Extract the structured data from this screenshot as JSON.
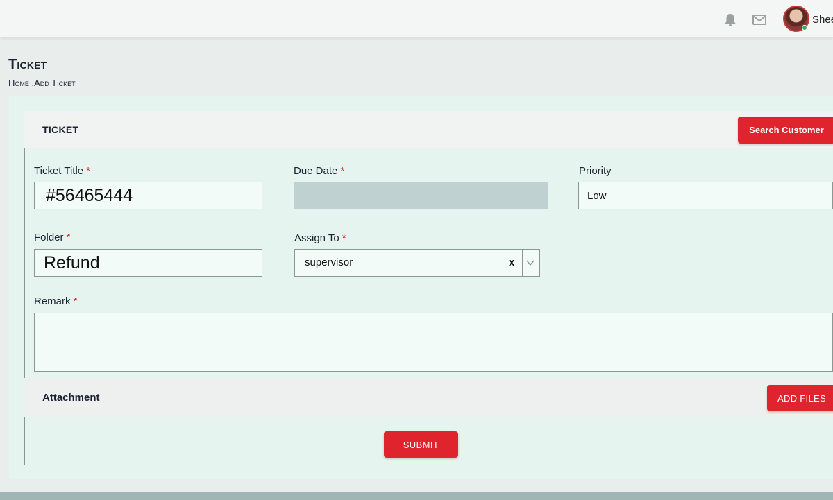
{
  "topbar": {
    "user_name": "Shee",
    "icons": {
      "bell": "bell-icon",
      "mail": "mail-icon"
    }
  },
  "page": {
    "title": "Ticket",
    "breadcrumb": "Home .Add Ticket"
  },
  "card": {
    "title": "TICKET",
    "search_customer_label": "Search Customer"
  },
  "form": {
    "ticket_title": {
      "label": "Ticket Title",
      "required": "*",
      "value": "#56465444"
    },
    "due_date": {
      "label": "Due Date",
      "required": "*",
      "value": ""
    },
    "priority": {
      "label": "Priority",
      "value": "Low"
    },
    "folder": {
      "label": "Folder",
      "required": "*",
      "value": "Refund"
    },
    "assign_to": {
      "label": "Assign To",
      "required": "*",
      "value": "supervisor",
      "clear": "x"
    },
    "remark": {
      "label": "Remark",
      "required": "*",
      "value": ""
    }
  },
  "attachment": {
    "title": "Attachment",
    "add_files_label": "ADD FILES"
  },
  "submit_label": "SUBMIT",
  "colors": {
    "accent_red": "#e0242e",
    "card_bg": "#e6f4ef",
    "disabled_field": "#bfd1d1"
  }
}
